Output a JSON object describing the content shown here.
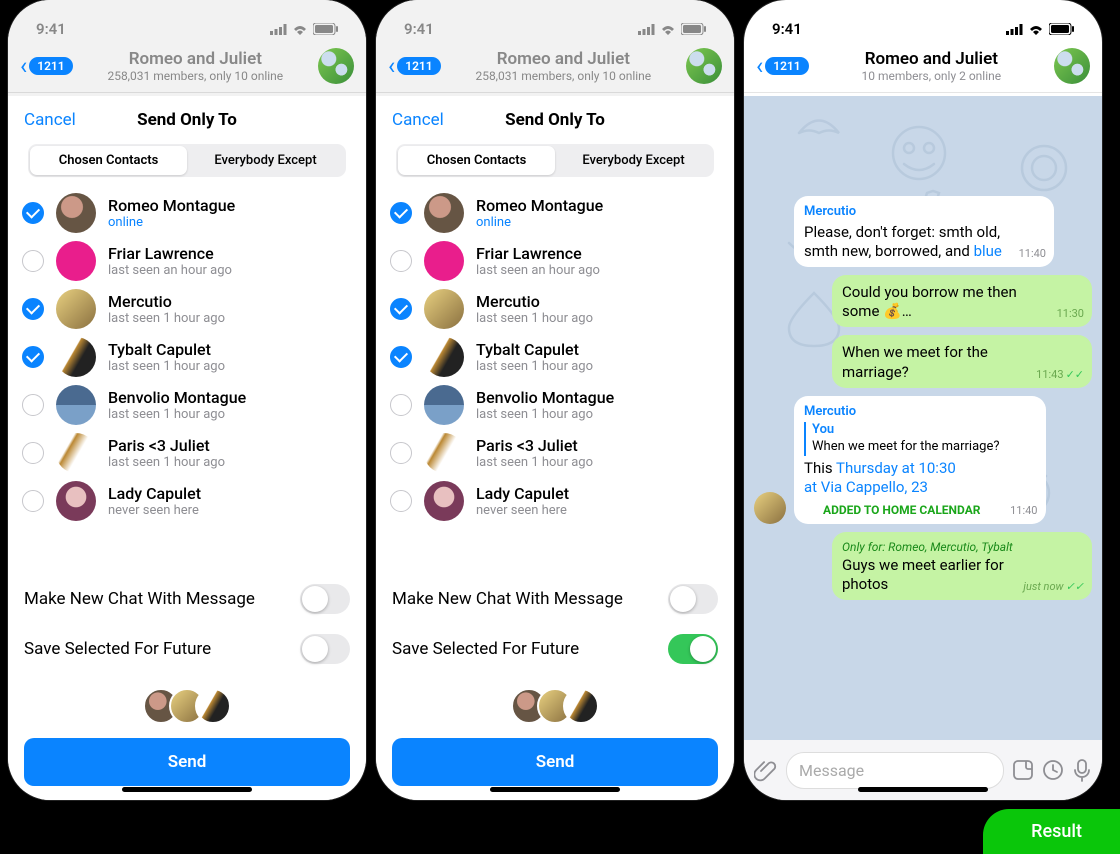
{
  "status": {
    "time": "9:41"
  },
  "header": {
    "back_count": "1211",
    "title": "Romeo and Juliet",
    "subtitle_big": "258,031 members, only 10 online",
    "subtitle_small": "10 members, only 2 online"
  },
  "sheet": {
    "cancel": "Cancel",
    "title": "Send Only To",
    "seg_chosen": "Chosen Contacts",
    "seg_except": "Everybody Except",
    "opt_newchat": "Make New Chat With Message",
    "opt_save": "Save Selected For Future",
    "send": "Send"
  },
  "contacts": [
    {
      "name": "Romeo Montague",
      "status": "online",
      "online": true,
      "checked": true,
      "av": "av-romeo"
    },
    {
      "name": "Friar Lawrence",
      "status": "last seen an hour ago",
      "online": false,
      "checked": false,
      "av": "av-friar"
    },
    {
      "name": "Mercutio",
      "status": "last seen 1 hour ago",
      "online": false,
      "checked": true,
      "av": "av-mercutio"
    },
    {
      "name": "Tybalt Capulet",
      "status": "last seen 1 hour ago",
      "online": false,
      "checked": true,
      "av": "av-tybalt"
    },
    {
      "name": "Benvolio Montague",
      "status": "last seen 1 hour ago",
      "online": false,
      "checked": false,
      "av": "av-benvolio"
    },
    {
      "name": "Paris <3 Juliet",
      "status": "last seen 1 hour ago",
      "online": false,
      "checked": false,
      "av": "av-paris"
    },
    {
      "name": "Lady Capulet",
      "status": "never seen here",
      "online": false,
      "checked": false,
      "av": "av-lady"
    }
  ],
  "chat": {
    "m1_sender": "Mercutio",
    "m1_text_a": "Please, don't forget: smth old, smth new, borrowed, and ",
    "m1_text_b": "blue",
    "m1_time": "11:40",
    "m2_text": "Could you borrow me then some 💰…",
    "m2_time": "11:30",
    "m3_text": "When we meet for the marriage?",
    "m3_time": "11:43",
    "m4_sender": "Mercutio",
    "m4_reply_who": "You",
    "m4_reply_text": "When we meet for the marriage?",
    "m4_text_a": "This  ",
    "m4_text_b": "Thursday at 10:30",
    "m4_link2": "at Via Cappello, 23",
    "m4_time": "11:40",
    "m4_badge": "ADDED TO HOME CALENDAR",
    "m5_onlyfor": "Only for: Romeo, Mercutio, Tybalt",
    "m5_text": "Guys we meet earlier for photos",
    "m5_time": "just now",
    "input_placeholder": "Message"
  },
  "result_label": "Result"
}
